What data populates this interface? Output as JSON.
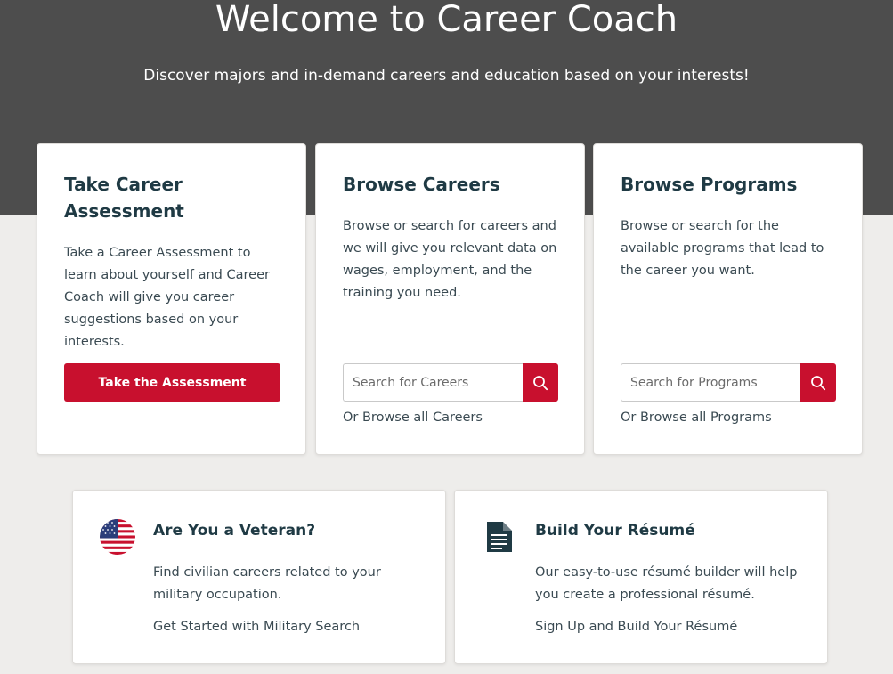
{
  "hero": {
    "title": "Welcome to Career Coach",
    "subtitle": "Discover majors and in-demand careers and education based on your interests!"
  },
  "assessment": {
    "title": "Take Career Assessment",
    "description": "Take a Career Assessment to learn about yourself and Career Coach will give you career suggestions based on your interests.",
    "button_label": "Take the Assessment"
  },
  "careers": {
    "title": "Browse Careers",
    "description": "Browse or search for careers and we will give you relevant data on wages, employment, and the training you need.",
    "search_placeholder": "Search for Careers",
    "search_value": "",
    "search_icon": "search-icon",
    "browse_link": "Or Browse all Careers"
  },
  "programs": {
    "title": "Browse Programs",
    "description": "Browse or search for the available programs that lead to the career you want.",
    "search_placeholder": "Search for Programs",
    "search_value": "",
    "search_icon": "search-icon",
    "browse_link": "Or Browse all Programs"
  },
  "veteran": {
    "icon": "us-flag-icon",
    "title": "Are You a Veteran?",
    "description": "Find civilian careers related to your military occupation.",
    "link": "Get Started with Military Search"
  },
  "resume": {
    "icon": "document-icon",
    "title": "Build Your Résumé",
    "description": "Our easy-to-use résumé builder will help you create a professional résumé.",
    "link": "Sign Up and Build Your Résumé"
  },
  "colors": {
    "accent": "#c8102e",
    "hero_bg": "#4d4d4d",
    "page_bg": "#eeedeb",
    "heading": "#1f3a44"
  }
}
